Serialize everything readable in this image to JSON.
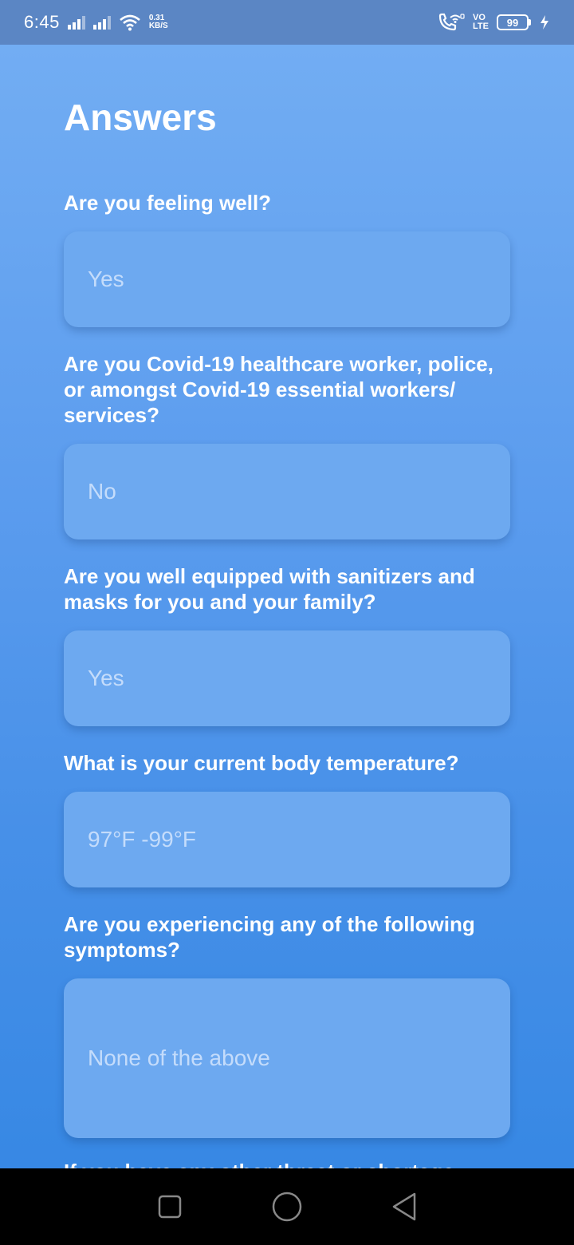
{
  "status_bar": {
    "time": "6:45",
    "speed_value": "0.31",
    "speed_unit": "KB/S",
    "volte_top": "VO",
    "volte_bottom": "LTE",
    "battery_level": "99"
  },
  "page": {
    "title": "Answers"
  },
  "questions": [
    {
      "question": "Are you feeling well?",
      "answer": "Yes"
    },
    {
      "question": "Are you Covid-19 healthcare worker, police, or amongst Covid-19 essential workers/ services?",
      "answer": "No"
    },
    {
      "question": "Are you well equipped with sanitizers and masks for you and your family?",
      "answer": "Yes"
    },
    {
      "question": "What is your current body temperature?",
      "answer": "97°F -99°F"
    },
    {
      "question": "Are you experiencing any of the following symptoms?",
      "answer": "None of the above"
    }
  ],
  "next_question_partial": "If you have any other threat or shortage",
  "icons": {
    "signal": "cellular-signal-icon",
    "wifi": "wifi-icon",
    "wifi_calling": "wifi-calling-icon",
    "battery": "battery-icon",
    "charging": "charging-bolt-icon",
    "nav_recent": "recent-apps-icon",
    "nav_home": "home-icon",
    "nav_back": "back-icon"
  },
  "colors": {
    "status_bar": "#5b86c4",
    "gradient_top": "#72adf3",
    "gradient_bottom": "#3788e4",
    "field_bg": "#6da9f0"
  }
}
